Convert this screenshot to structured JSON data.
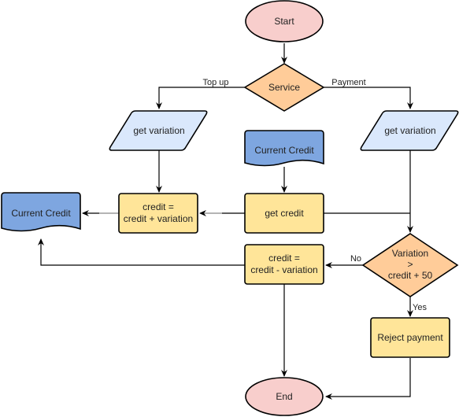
{
  "colors": {
    "terminal": "#f8cecc",
    "decision": "#ffcc99",
    "io": "#dae8fc",
    "document": "#7ea6e0",
    "process": "#ffe599"
  },
  "nodes": {
    "start": {
      "text": "Start",
      "type": "terminal"
    },
    "service": {
      "text": "Service",
      "type": "decision"
    },
    "get_variation_left": {
      "text": "get variation",
      "type": "io"
    },
    "get_variation_right": {
      "text": "get variation",
      "type": "io"
    },
    "current_credit_top": {
      "text": "Current Credit",
      "type": "document"
    },
    "current_credit_left": {
      "text": "Current Credit",
      "type": "document"
    },
    "credit_plus": {
      "lines": [
        "credit =",
        "credit + variation"
      ],
      "type": "process"
    },
    "get_credit": {
      "text": "get credit",
      "type": "process"
    },
    "credit_minus": {
      "lines": [
        "credit =",
        "credit - variation"
      ],
      "type": "process"
    },
    "variation_check": {
      "lines": [
        "Variation",
        ">",
        "credit + 50"
      ],
      "type": "decision"
    },
    "reject_payment": {
      "text": "Reject payment",
      "type": "process"
    },
    "end": {
      "text": "End",
      "type": "terminal"
    }
  },
  "edge_labels": {
    "top_up": "Top up",
    "payment": "Payment",
    "no": "No",
    "yes": "Yes"
  }
}
